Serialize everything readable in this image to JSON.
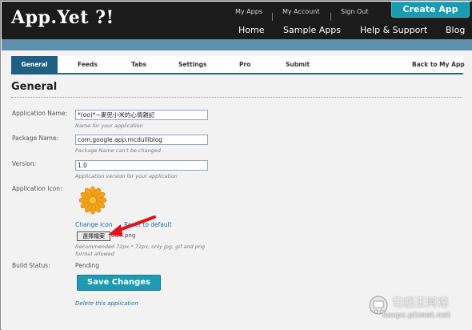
{
  "header": {
    "logo": "App.Yet ?!",
    "top_links": [
      "My Apps",
      "My Account",
      "Sign Out"
    ],
    "create_app": "Create App",
    "main_nav": [
      "Home",
      "Sample Apps",
      "Help & Support",
      "Blog"
    ]
  },
  "tabs": {
    "items": [
      "General",
      "Feeds",
      "Tabs",
      "Settings",
      "Pro",
      "Submit"
    ],
    "back": "Back to My App"
  },
  "page": {
    "title": "General"
  },
  "form": {
    "app_name_label": "Application Name:",
    "app_name_value": "*(oo)*~麥兜小米的心情雜記",
    "app_name_hint": "Name for your application",
    "package_label": "Package Name:",
    "package_value": "com.google.app.mcdulllblog",
    "package_hint": "Package Name can't be changed",
    "version_label": "Version:",
    "version_value": "1.0",
    "version_hint": "Application version for your application",
    "icon_label": "Application Icon:",
    "change_icon": "Change icon",
    "reset_default": "Reset to default",
    "file_button": "選擇檔案",
    "file_name": "dulll.png",
    "icon_hint": "Recommended 72px * 72px, only jpg, gif and png format allowed",
    "build_label": "Build Status:",
    "build_value": "Pending",
    "save_button": "Save Changes",
    "delete_link": "Delete this application"
  },
  "watermark": {
    "title": "電腦王阿達",
    "url": "kocpc.pixnet.net"
  },
  "colors": {
    "accent": "#1e9ab3",
    "tab_active": "#1f5f84",
    "strip": "#5f91ac",
    "arrow": "#e3121b"
  }
}
